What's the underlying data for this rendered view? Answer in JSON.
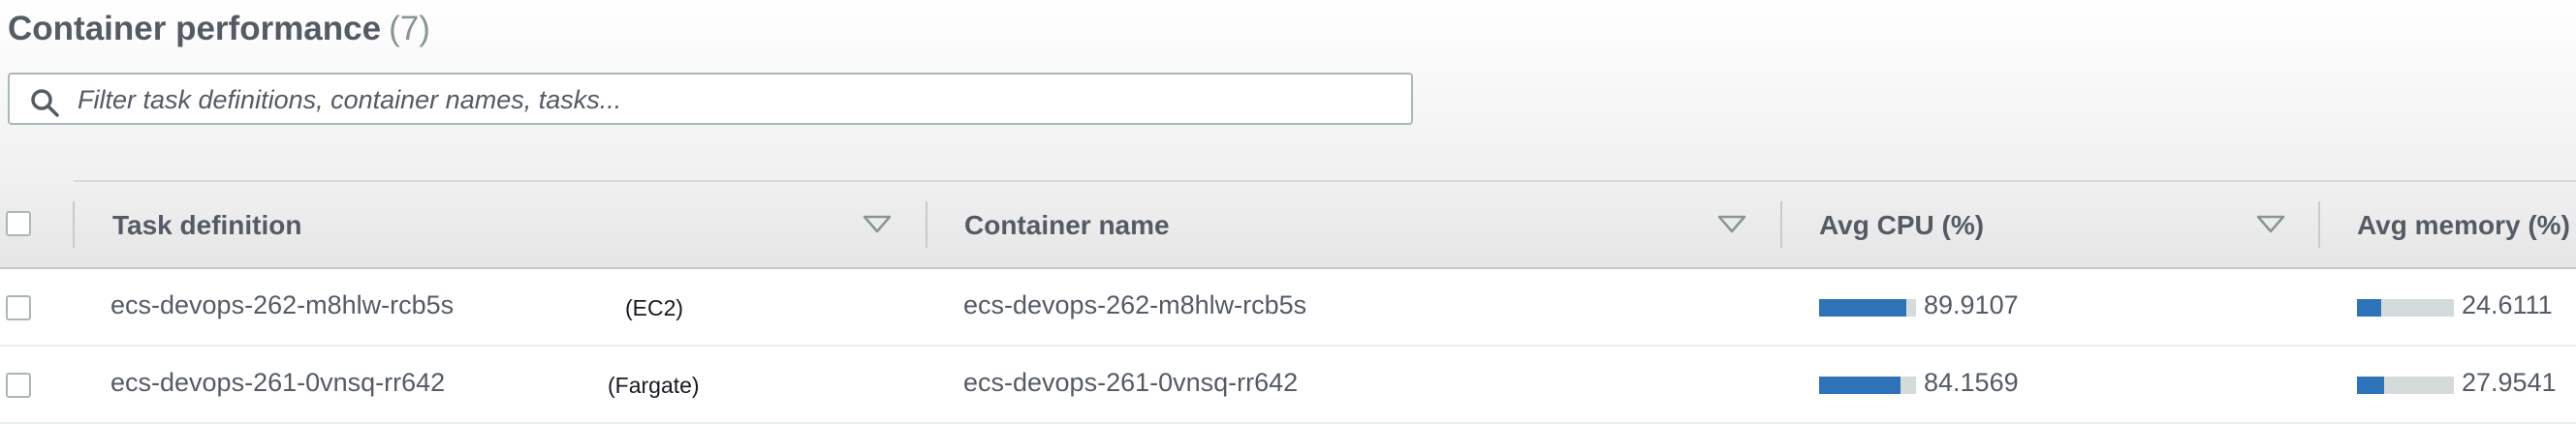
{
  "header": {
    "title": "Container performance",
    "count": "(7)"
  },
  "search": {
    "placeholder": "Filter task definitions, container names, tasks...",
    "value": ""
  },
  "table": {
    "columns": {
      "task_definition": "Task definition",
      "container_name": "Container name",
      "avg_cpu": "Avg CPU (%)",
      "avg_memory": "Avg memory (%)"
    },
    "rows": [
      {
        "task_definition": "ecs-devops-262-m8hlw-rcb5s",
        "launch_type": "(EC2)",
        "container_name": "ecs-devops-262-m8hlw-rcb5s",
        "avg_cpu": "89.9107",
        "avg_memory": "24.6111"
      },
      {
        "task_definition": "ecs-devops-261-0vnsq-rr642",
        "launch_type": "(Fargate)",
        "container_name": "ecs-devops-261-0vnsq-rr642",
        "avg_cpu": "84.1569",
        "avg_memory": "27.9541"
      }
    ]
  },
  "colors": {
    "bar_fill": "#2e73b8",
    "bar_track": "#d5dbdb"
  },
  "icons": [
    "search-icon",
    "sort-descending-icon"
  ]
}
